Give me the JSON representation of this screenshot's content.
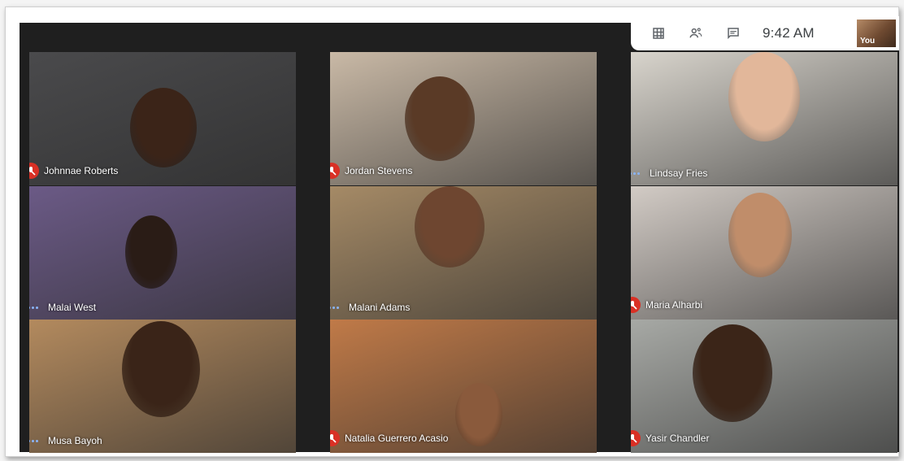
{
  "toolbar": {
    "time": "9:42 AM",
    "self_label": "You",
    "icons": [
      "grid-view-icon",
      "people-icon",
      "chat-icon"
    ]
  },
  "participants": [
    {
      "name": "Johnnae Roberts",
      "status": "muted",
      "bg": "#4a4a4c",
      "skin": "#3b2418"
    },
    {
      "name": "Jordan Stevens",
      "status": "muted",
      "bg": "#c9b9a6",
      "skin": "#5a3a26"
    },
    {
      "name": "Lindsay Fries",
      "status": "speaking",
      "bg": "#d8d4cc",
      "skin": "#e2b79a"
    },
    {
      "name": "Malai West",
      "status": "speaking",
      "bg": "#6b5a86",
      "skin": "#2a1c16"
    },
    {
      "name": "Malani Adams",
      "status": "speaking",
      "bg": "#a58a66",
      "skin": "#6e4630"
    },
    {
      "name": "Maria Alharbi",
      "status": "muted",
      "bg": "#d2cbc5",
      "skin": "#c08d6a"
    },
    {
      "name": "Musa Bayoh",
      "status": "speaking",
      "bg": "#b38a5e",
      "skin": "#3a2418"
    },
    {
      "name": "Natalia Guerrero Acasio",
      "status": "muted",
      "bg": "#c07a48",
      "skin": "#8a5a3c"
    },
    {
      "name": "Yasir Chandler",
      "status": "muted",
      "bg": "#a7a9a5",
      "skin": "#3b2518"
    }
  ]
}
